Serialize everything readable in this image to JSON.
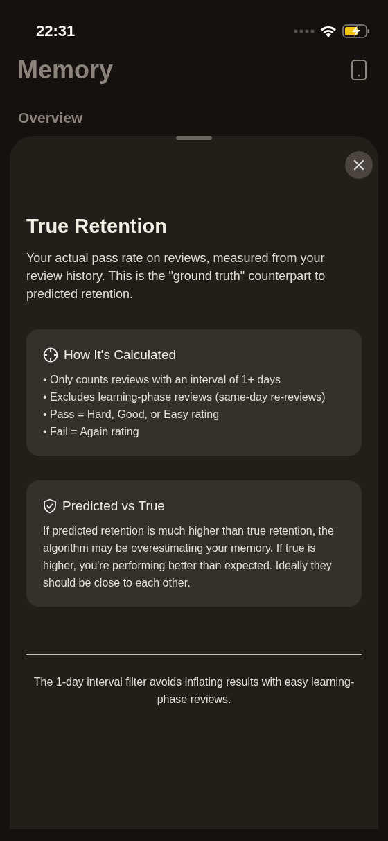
{
  "status_bar": {
    "time": "22:31"
  },
  "header": {
    "title": "Memory",
    "section": "Overview"
  },
  "sheet": {
    "title": "True Retention",
    "description": "Your actual pass rate on reviews, measured from your review history. This is the \"ground truth\" counterpart to predicted retention.",
    "cards": [
      {
        "kind": "target",
        "heading": "How It's Calculated",
        "lines": [
          "• Only counts reviews with an interval of 1+ days",
          "• Excludes learning-phase reviews (same-day re-reviews)",
          "• Pass = Hard, Good, or Easy rating",
          "• Fail = Again rating"
        ]
      },
      {
        "kind": "shield",
        "heading": "Predicted vs True",
        "lines": [
          "If predicted retention is much higher than true retention, the algorithm may be overestimating your memory. If true is higher, you're performing better than expected. Ideally they should be close to each other."
        ]
      }
    ],
    "footer": "The 1-day interval filter avoids inflating results with easy learning-phase reviews."
  }
}
